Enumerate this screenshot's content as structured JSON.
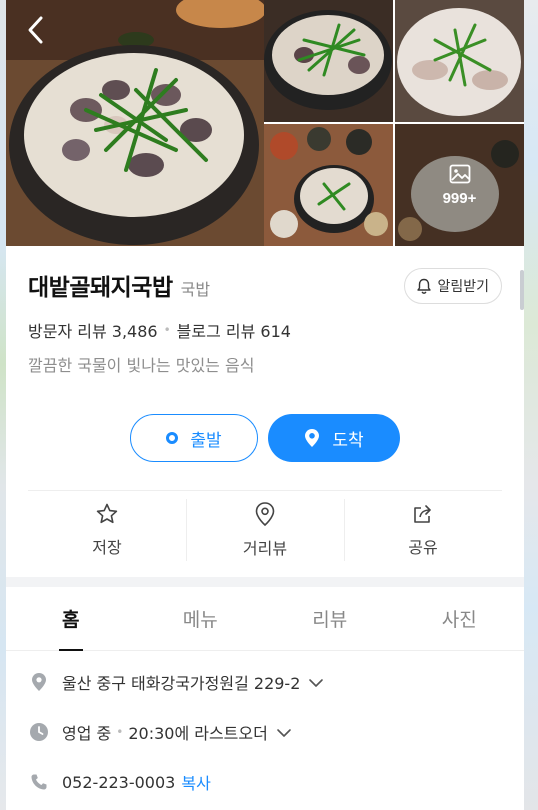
{
  "place": {
    "name": "대밭골돼지국밥",
    "category": "국밥",
    "visitor_reviews": "방문자 리뷰 3,486",
    "blog_reviews": "블로그 리뷰 614",
    "description": "깔끔한 국물이 빛나는 맛있는 음식"
  },
  "photos": {
    "more_count": "999+"
  },
  "alarm_label": "알림받기",
  "route": {
    "start_label": "출발",
    "arrive_label": "도착"
  },
  "actions": {
    "save": "저장",
    "street_view": "거리뷰",
    "share": "공유"
  },
  "tabs": [
    {
      "label": "홈"
    },
    {
      "label": "메뉴"
    },
    {
      "label": "리뷰"
    },
    {
      "label": "사진"
    }
  ],
  "details": {
    "address": "울산 중구 태화강국가정원길 229-2",
    "status": "영업 중",
    "last_order": "20:30에 라스트오더",
    "phone": "052-223-0003",
    "copy_label": "복사"
  },
  "colors": {
    "accent": "#1a8cff"
  }
}
